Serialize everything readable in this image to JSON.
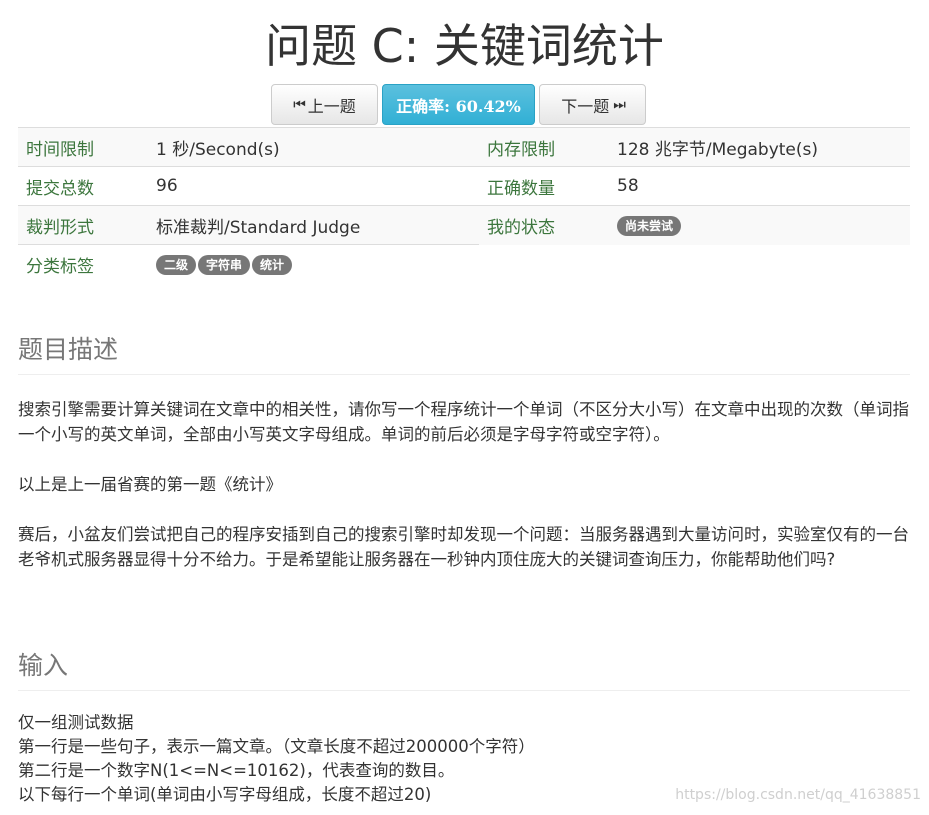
{
  "title": "问题 C: 关键词统计",
  "nav": {
    "prev_label": "上一题",
    "accuracy_label": "正确率: 60.42%",
    "next_label": "下一题"
  },
  "info": {
    "time_limit_key": "时间限制",
    "time_limit_val": "1 秒/Second(s)",
    "memory_limit_key": "内存限制",
    "memory_limit_val": "128 兆字节/Megabyte(s)",
    "submit_key": "提交总数",
    "submit_val": "96",
    "accepted_key": "正确数量",
    "accepted_val": "58",
    "judge_key": "裁判形式",
    "judge_val": "标准裁判/Standard Judge",
    "status_key": "我的状态",
    "status_badge": "尚未尝试",
    "tags_key": "分类标签",
    "tags": [
      "二级",
      "字符串",
      "统计"
    ]
  },
  "description": {
    "heading": "题目描述",
    "p1": "搜索引擎需要计算关键词在文章中的相关性，请你写一个程序统计一个单词（不区分大小写）在文章中出现的次数（单词指一个小写的英文单词，全部由小写英文字母组成。单词的前后必须是字母字符或空字符）。",
    "p2": "以上是上一届省赛的第一题《统计》",
    "p3": "赛后，小盆友们尝试把自己的程序安插到自己的搜索引擎时却发现一个问题：当服务器遇到大量访问时，实验室仅有的一台老爷机式服务器显得十分不给力。于是希望能让服务器在一秒钟内顶住庞大的关键词查询压力，你能帮助他们吗?"
  },
  "input": {
    "heading": "输入",
    "lines": [
      "仅一组测试数据",
      "第一行是一些句子，表示一篇文章。（文章长度不超过200000个字符）",
      "第二行是一个数字N(1<=N<=10162)，代表查询的数目。",
      "以下每行一个单词(单词由小写字母组成，长度不超过20)"
    ]
  },
  "watermark": "https://blog.csdn.net/qq_41638851"
}
